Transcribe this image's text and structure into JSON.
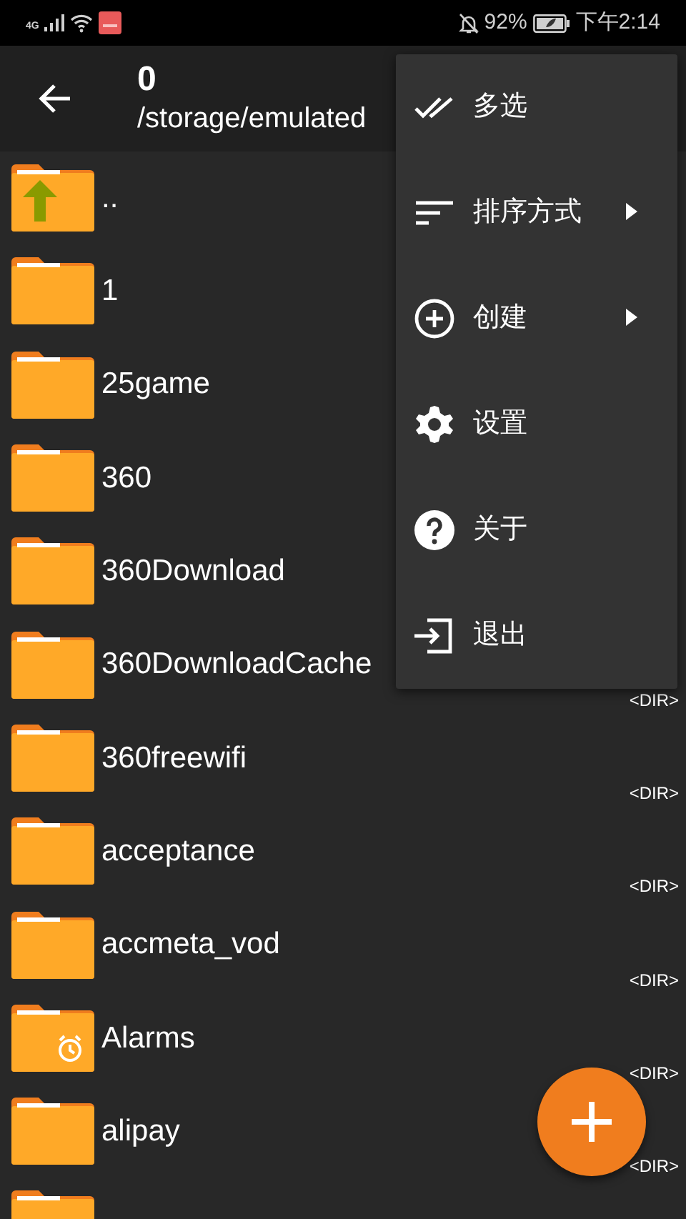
{
  "status_bar": {
    "network": "4G",
    "battery": "92%",
    "time": "下午2:14"
  },
  "header": {
    "title": "0",
    "path": "/storage/emulated"
  },
  "files": [
    {
      "name": "..",
      "kind": "up"
    },
    {
      "name": "1",
      "kind": "folder"
    },
    {
      "name": "25game",
      "kind": "folder"
    },
    {
      "name": "360",
      "kind": "folder"
    },
    {
      "name": "360Download",
      "kind": "folder"
    },
    {
      "name": "360DownloadCache",
      "kind": "folder",
      "detail": "<DIR>"
    },
    {
      "name": "360freewifi",
      "kind": "folder",
      "detail": "<DIR>"
    },
    {
      "name": "acceptance",
      "kind": "folder",
      "detail": "<DIR>"
    },
    {
      "name": "accmeta_vod",
      "kind": "folder",
      "detail": "<DIR>"
    },
    {
      "name": "Alarms",
      "kind": "alarm",
      "detail": "<DIR>"
    },
    {
      "name": "alipay",
      "kind": "folder",
      "detail": "<DIR>"
    },
    {
      "kind": "folder"
    }
  ],
  "menu": [
    {
      "label": "多选",
      "kind": "multiselect",
      "submenu": false
    },
    {
      "label": "排序方式",
      "kind": "sort",
      "submenu": true
    },
    {
      "label": "创建",
      "kind": "create",
      "submenu": true
    },
    {
      "label": "设置",
      "kind": "settings",
      "submenu": false
    },
    {
      "label": "关于",
      "kind": "about",
      "submenu": false
    },
    {
      "label": "退出",
      "kind": "exit",
      "submenu": false
    }
  ]
}
